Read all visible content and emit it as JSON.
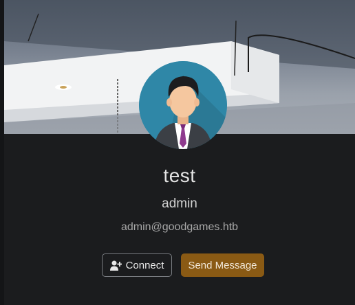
{
  "profile": {
    "name": "test",
    "role": "admin",
    "email": "admin@goodgames.htb"
  },
  "actions": {
    "connect_label": "Connect",
    "message_label": "Send Message"
  },
  "icons": {
    "connect": "user-plus-icon",
    "avatar": "user-avatar-icon"
  },
  "colors": {
    "background": "#1b1c1e",
    "avatar_bg": "#2f87a7",
    "message_button": "#8a5a14"
  }
}
